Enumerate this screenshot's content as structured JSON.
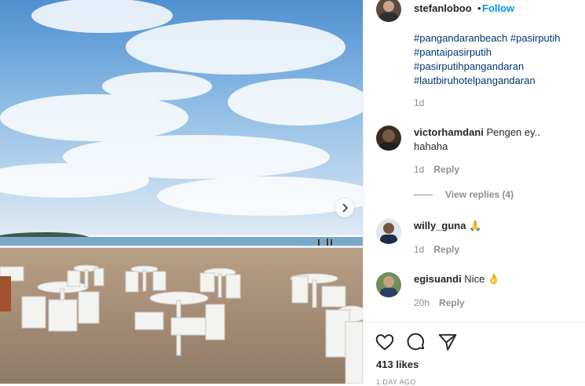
{
  "post": {
    "author": "stefanloboo",
    "separator": "•",
    "follow_label": "Follow",
    "hashtags": [
      "#pangandaranbeach #pasirputih",
      "#pantaipasirputih",
      "#pasirputihpangandaran",
      "#lautbiruhotelpangandaran"
    ],
    "caption_age": "1d",
    "likes": "413 likes",
    "posted": "1 DAY AGO"
  },
  "comments": [
    {
      "user": "victorhamdani",
      "text": " Pengen ey..",
      "text2": "hahaha",
      "age": "1d",
      "reply_label": "Reply"
    },
    {
      "user": "willy_guna",
      "text": " 🙏",
      "age": "1d",
      "reply_label": "Reply"
    },
    {
      "user": "egisuandi",
      "text": " Nice 👌",
      "age": "20h",
      "reply_label": "Reply"
    }
  ],
  "view_replies_label": "View replies (4)",
  "icons": {
    "next": "chevron-right-icon",
    "like": "heart-icon",
    "comment": "comment-icon",
    "share": "paper-plane-icon"
  },
  "colors": {
    "link": "#00376b",
    "follow": "#0095f6",
    "muted": "#8e8e8e"
  }
}
